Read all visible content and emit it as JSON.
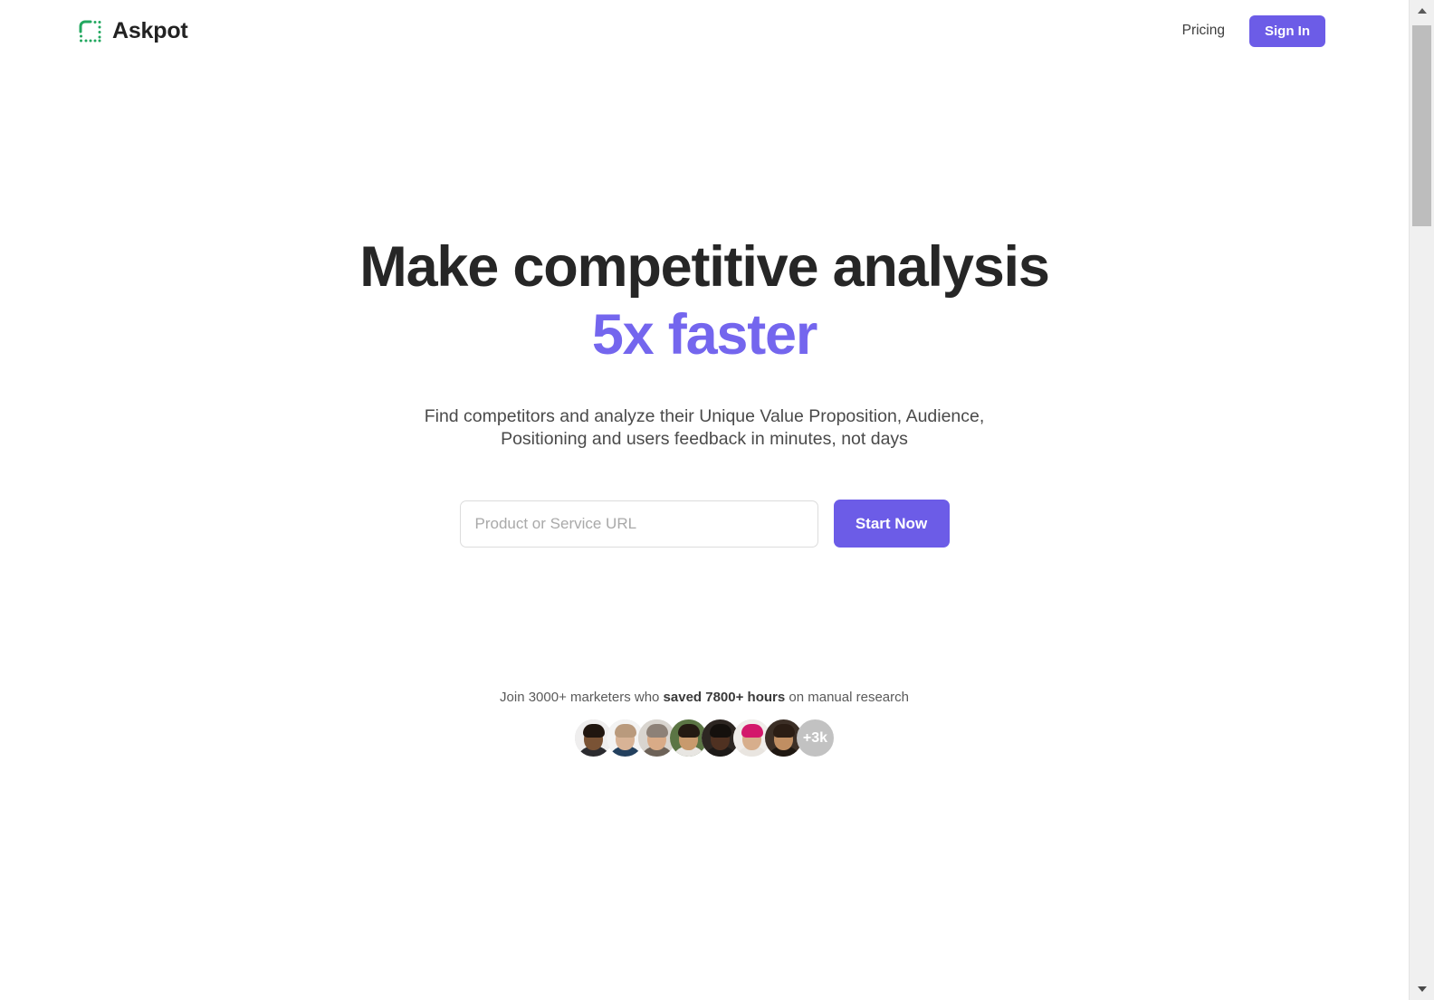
{
  "header": {
    "brand_name": "Askpot",
    "brand_icon": "dashed-square-logo-icon",
    "nav": {
      "pricing_label": "Pricing",
      "signin_label": "Sign In"
    }
  },
  "hero": {
    "title_line1": "Make competitive analysis",
    "title_line2": "5x faster",
    "subtitle_line1": "Find competitors and analyze their Unique Value Proposition, Audience,",
    "subtitle_line2": "Positioning and users feedback in minutes, not days"
  },
  "search": {
    "placeholder": "Product or Service URL",
    "value": "",
    "submit_label": "Start Now"
  },
  "social_proof": {
    "text_prefix": "Join 3000+ marketers who ",
    "text_highlight": "saved 7800+ hours",
    "text_suffix": " on manual research",
    "more_count_label": "+3k",
    "avatars": [
      {
        "name": "avatar-1",
        "bg": "#efeeee",
        "skin": "#7a5335",
        "hair": "#20160f",
        "shirt": "#2b2b2f"
      },
      {
        "name": "avatar-2",
        "bg": "#f3f3f3",
        "skin": "#d8b396",
        "hair": "#b99a7d",
        "shirt": "#23405e"
      },
      {
        "name": "avatar-3",
        "bg": "#d9d5cf",
        "skin": "#d9ab87",
        "hair": "#8d8177",
        "shirt": "#6d6258"
      },
      {
        "name": "avatar-4",
        "bg": "#5b7544",
        "skin": "#c89a6d",
        "hair": "#241a12",
        "shirt": "#e8e6e2"
      },
      {
        "name": "avatar-5",
        "bg": "#2d2622",
        "skin": "#4f3121",
        "hair": "#14100d",
        "shirt": "#1d1a18"
      },
      {
        "name": "avatar-6",
        "bg": "#f0edea",
        "skin": "#d7ae8c",
        "hair": "#d3186b",
        "shirt": "#e9e5e0"
      },
      {
        "name": "avatar-7",
        "bg": "#3c2f26",
        "skin": "#c08e62",
        "hair": "#2b1d14",
        "shirt": "#1f1812"
      }
    ]
  },
  "scrollbar": {
    "up_label": "▲",
    "down_label": "▼"
  },
  "colors": {
    "brand_green": "#22a85f",
    "accent_purple": "#6c5ce7",
    "headline_purple": "#7466ee"
  }
}
